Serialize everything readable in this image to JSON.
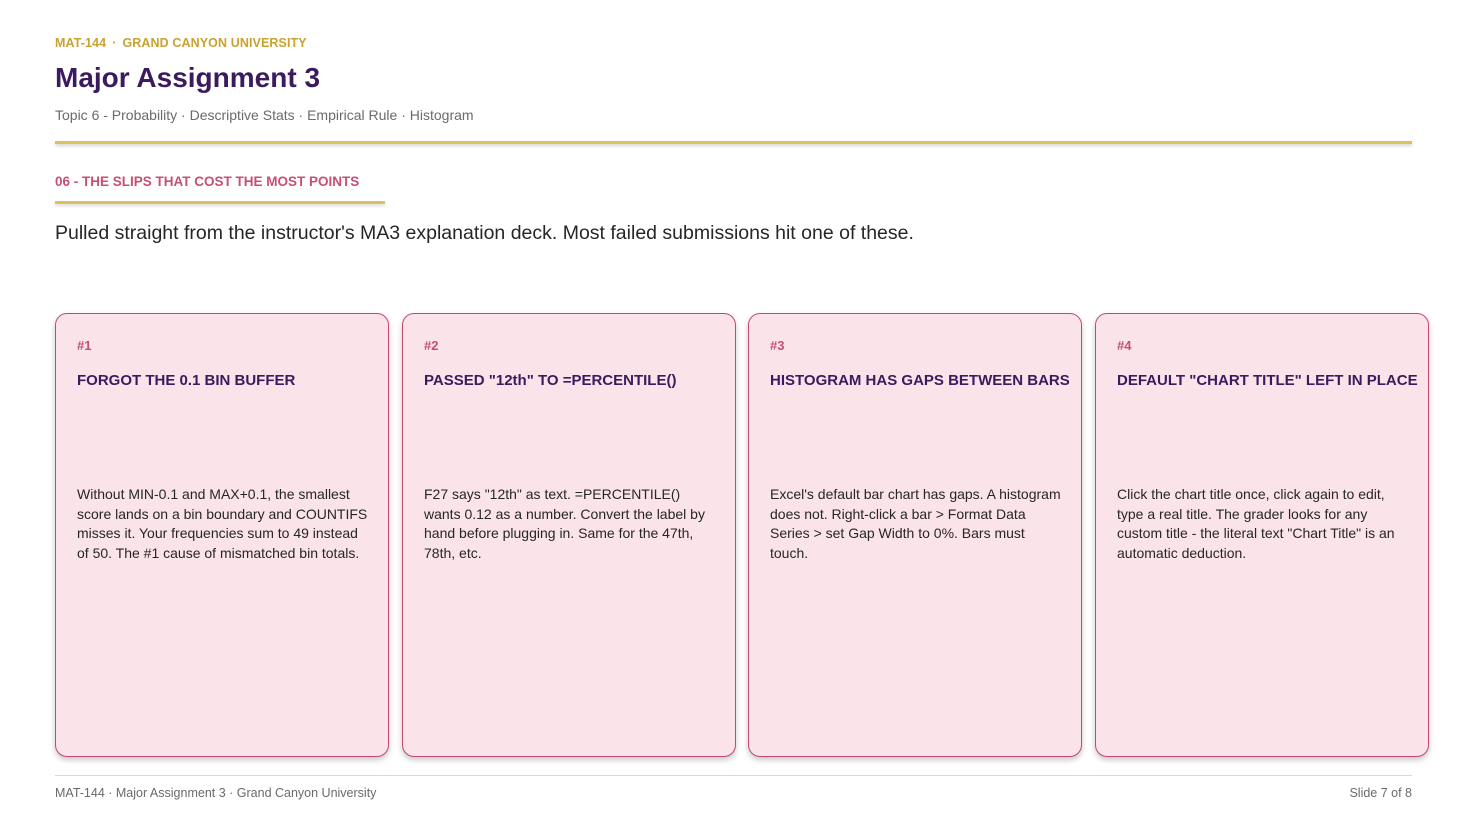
{
  "header": {
    "course_code": "MAT-144",
    "separator": "·",
    "university": "GRAND CANYON UNIVERSITY",
    "title": "Major Assignment 3",
    "subtitle": "Topic 6 - Probability · Descriptive Stats · Empirical Rule · Histogram"
  },
  "section": {
    "label": "06 - THE SLIPS THAT COST THE MOST POINTS",
    "intro": "Pulled straight from the instructor's MA3 explanation deck. Most failed submissions hit one of these."
  },
  "cards": [
    {
      "number": "#1",
      "title": "FORGOT THE 0.1 BIN BUFFER",
      "body": "Without MIN-0.1 and MAX+0.1, the smallest score lands on a bin boundary and COUNTIFS misses it. Your frequencies sum to 49 instead of 50. The #1 cause of mismatched bin totals."
    },
    {
      "number": "#2",
      "title": "PASSED \"12th\" TO =PERCENTILE()",
      "body": "F27 says \"12th\" as text. =PERCENTILE() wants 0.12 as a number. Convert the label by hand before plugging in. Same for the 47th, 78th, etc."
    },
    {
      "number": "#3",
      "title": "HISTOGRAM HAS GAPS BETWEEN BARS",
      "body": "Excel's default bar chart has gaps. A histogram does not. Right-click a bar > Format Data Series > set Gap Width to 0%. Bars must touch."
    },
    {
      "number": "#4",
      "title": "DEFAULT \"CHART TITLE\" LEFT IN PLACE",
      "body": "Click the chart title once, click again to edit, type a real title. The grader looks for any custom title - the literal text \"Chart Title\" is an automatic deduction."
    }
  ],
  "footer": {
    "left": "MAT-144 · Major Assignment 3 · Grand Canyon University",
    "right": "Slide 7 of 8"
  },
  "colors": {
    "accent_gold": "#c9a22f",
    "title_purple": "#3b1a5e",
    "section_pink": "#c74f72",
    "card_fill": "#fbe3ea",
    "card_border": "#c14a6e"
  }
}
